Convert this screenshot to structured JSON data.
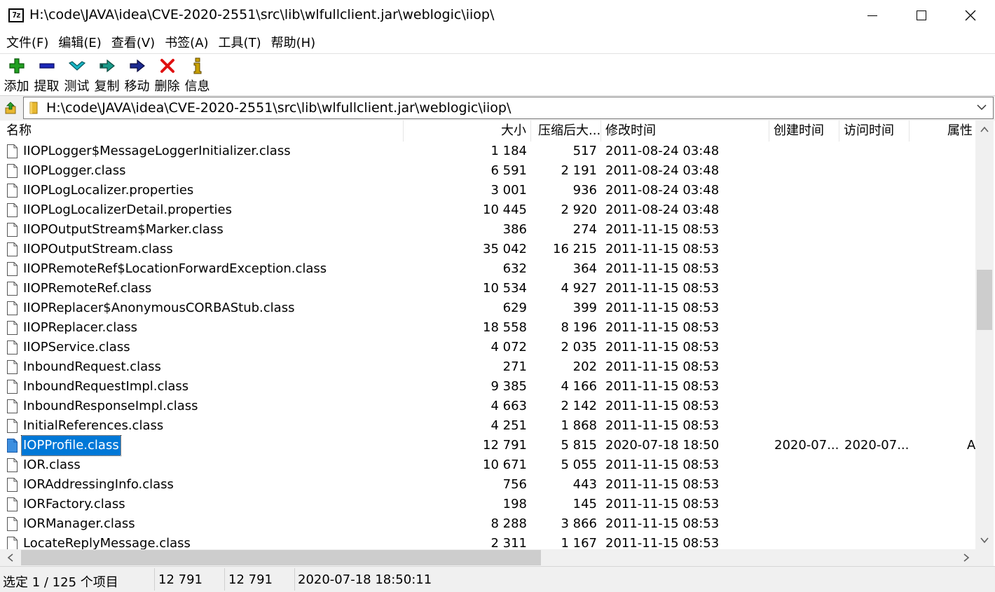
{
  "window": {
    "app_icon_text": "7z",
    "title": "H:\\code\\JAVA\\idea\\CVE-2020-2551\\src\\lib\\wlfullclient.jar\\weblogic\\iiop\\"
  },
  "menu": [
    {
      "label": "文件(F)"
    },
    {
      "label": "编辑(E)"
    },
    {
      "label": "查看(V)"
    },
    {
      "label": "书签(A)"
    },
    {
      "label": "工具(T)"
    },
    {
      "label": "帮助(H)"
    }
  ],
  "toolbar": [
    {
      "label": "添加",
      "icon": "add-icon",
      "color": "#22a022"
    },
    {
      "label": "提取",
      "icon": "extract-icon",
      "color": "#1c28b8"
    },
    {
      "label": "测试",
      "icon": "test-icon",
      "color": "#18b4c4"
    },
    {
      "label": "复制",
      "icon": "copy-icon",
      "color": "#1a9a8a"
    },
    {
      "label": "移动",
      "icon": "move-icon",
      "color": "#1c2a90"
    },
    {
      "label": "删除",
      "icon": "delete-icon",
      "color": "#e01010"
    },
    {
      "label": "信息",
      "icon": "info-icon",
      "color": "#c8a000"
    }
  ],
  "address": {
    "path": "H:\\code\\JAVA\\idea\\CVE-2020-2551\\src\\lib\\wlfullclient.jar\\weblogic\\iiop\\"
  },
  "columns": {
    "name": "名称",
    "size": "大小",
    "packed": "压缩后大...",
    "modified": "修改时间",
    "created": "创建时间",
    "accessed": "访问时间",
    "attributes": "属性"
  },
  "files": [
    {
      "name": "IIOPLogger$MessageLoggerInitializer.class",
      "size": "1 184",
      "packed": "517",
      "modified": "2011-08-24 03:48",
      "created": "",
      "accessed": "",
      "attr": ""
    },
    {
      "name": "IIOPLogger.class",
      "size": "6 591",
      "packed": "2 191",
      "modified": "2011-08-24 03:48",
      "created": "",
      "accessed": "",
      "attr": ""
    },
    {
      "name": "IIOPLogLocalizer.properties",
      "size": "3 001",
      "packed": "936",
      "modified": "2011-08-24 03:48",
      "created": "",
      "accessed": "",
      "attr": ""
    },
    {
      "name": "IIOPLogLocalizerDetail.properties",
      "size": "10 445",
      "packed": "2 920",
      "modified": "2011-08-24 03:48",
      "created": "",
      "accessed": "",
      "attr": ""
    },
    {
      "name": "IIOPOutputStream$Marker.class",
      "size": "386",
      "packed": "274",
      "modified": "2011-11-15 08:53",
      "created": "",
      "accessed": "",
      "attr": ""
    },
    {
      "name": "IIOPOutputStream.class",
      "size": "35 042",
      "packed": "16 215",
      "modified": "2011-11-15 08:53",
      "created": "",
      "accessed": "",
      "attr": ""
    },
    {
      "name": "IIOPRemoteRef$LocationForwardException.class",
      "size": "632",
      "packed": "364",
      "modified": "2011-11-15 08:53",
      "created": "",
      "accessed": "",
      "attr": ""
    },
    {
      "name": "IIOPRemoteRef.class",
      "size": "10 534",
      "packed": "4 927",
      "modified": "2011-11-15 08:53",
      "created": "",
      "accessed": "",
      "attr": ""
    },
    {
      "name": "IIOPReplacer$AnonymousCORBAStub.class",
      "size": "629",
      "packed": "399",
      "modified": "2011-11-15 08:53",
      "created": "",
      "accessed": "",
      "attr": ""
    },
    {
      "name": "IIOPReplacer.class",
      "size": "18 558",
      "packed": "8 196",
      "modified": "2011-11-15 08:53",
      "created": "",
      "accessed": "",
      "attr": ""
    },
    {
      "name": "IIOPService.class",
      "size": "4 072",
      "packed": "2 035",
      "modified": "2011-11-15 08:53",
      "created": "",
      "accessed": "",
      "attr": ""
    },
    {
      "name": "InboundRequest.class",
      "size": "271",
      "packed": "202",
      "modified": "2011-11-15 08:53",
      "created": "",
      "accessed": "",
      "attr": ""
    },
    {
      "name": "InboundRequestImpl.class",
      "size": "9 385",
      "packed": "4 166",
      "modified": "2011-11-15 08:53",
      "created": "",
      "accessed": "",
      "attr": ""
    },
    {
      "name": "InboundResponseImpl.class",
      "size": "4 663",
      "packed": "2 142",
      "modified": "2011-11-15 08:53",
      "created": "",
      "accessed": "",
      "attr": ""
    },
    {
      "name": "InitialReferences.class",
      "size": "4 251",
      "packed": "1 868",
      "modified": "2011-11-15 08:53",
      "created": "",
      "accessed": "",
      "attr": ""
    },
    {
      "name": "IOPProfile.class",
      "size": "12 791",
      "packed": "5 815",
      "modified": "2020-07-18 18:50",
      "created": "2020-07...",
      "accessed": "2020-07...",
      "attr": "A",
      "selected": true
    },
    {
      "name": "IOR.class",
      "size": "10 671",
      "packed": "5 055",
      "modified": "2011-11-15 08:53",
      "created": "",
      "accessed": "",
      "attr": ""
    },
    {
      "name": "IORAddressingInfo.class",
      "size": "756",
      "packed": "443",
      "modified": "2011-11-15 08:53",
      "created": "",
      "accessed": "",
      "attr": ""
    },
    {
      "name": "IORFactory.class",
      "size": "198",
      "packed": "145",
      "modified": "2011-11-15 08:53",
      "created": "",
      "accessed": "",
      "attr": ""
    },
    {
      "name": "IORManager.class",
      "size": "8 288",
      "packed": "3 866",
      "modified": "2011-11-15 08:53",
      "created": "",
      "accessed": "",
      "attr": ""
    },
    {
      "name": "LocateReplyMessage.class",
      "size": "2 311",
      "packed": "1 167",
      "modified": "2011-11-15 08:53",
      "created": "",
      "accessed": "",
      "attr": ""
    }
  ],
  "status": {
    "selection": "选定 1 / 125 个项目",
    "size": "12 791",
    "packed": "12 791",
    "modified": "2020-07-18 18:50:11"
  },
  "colors": {
    "selection": "#0078d7",
    "folder": "#e8b830"
  }
}
